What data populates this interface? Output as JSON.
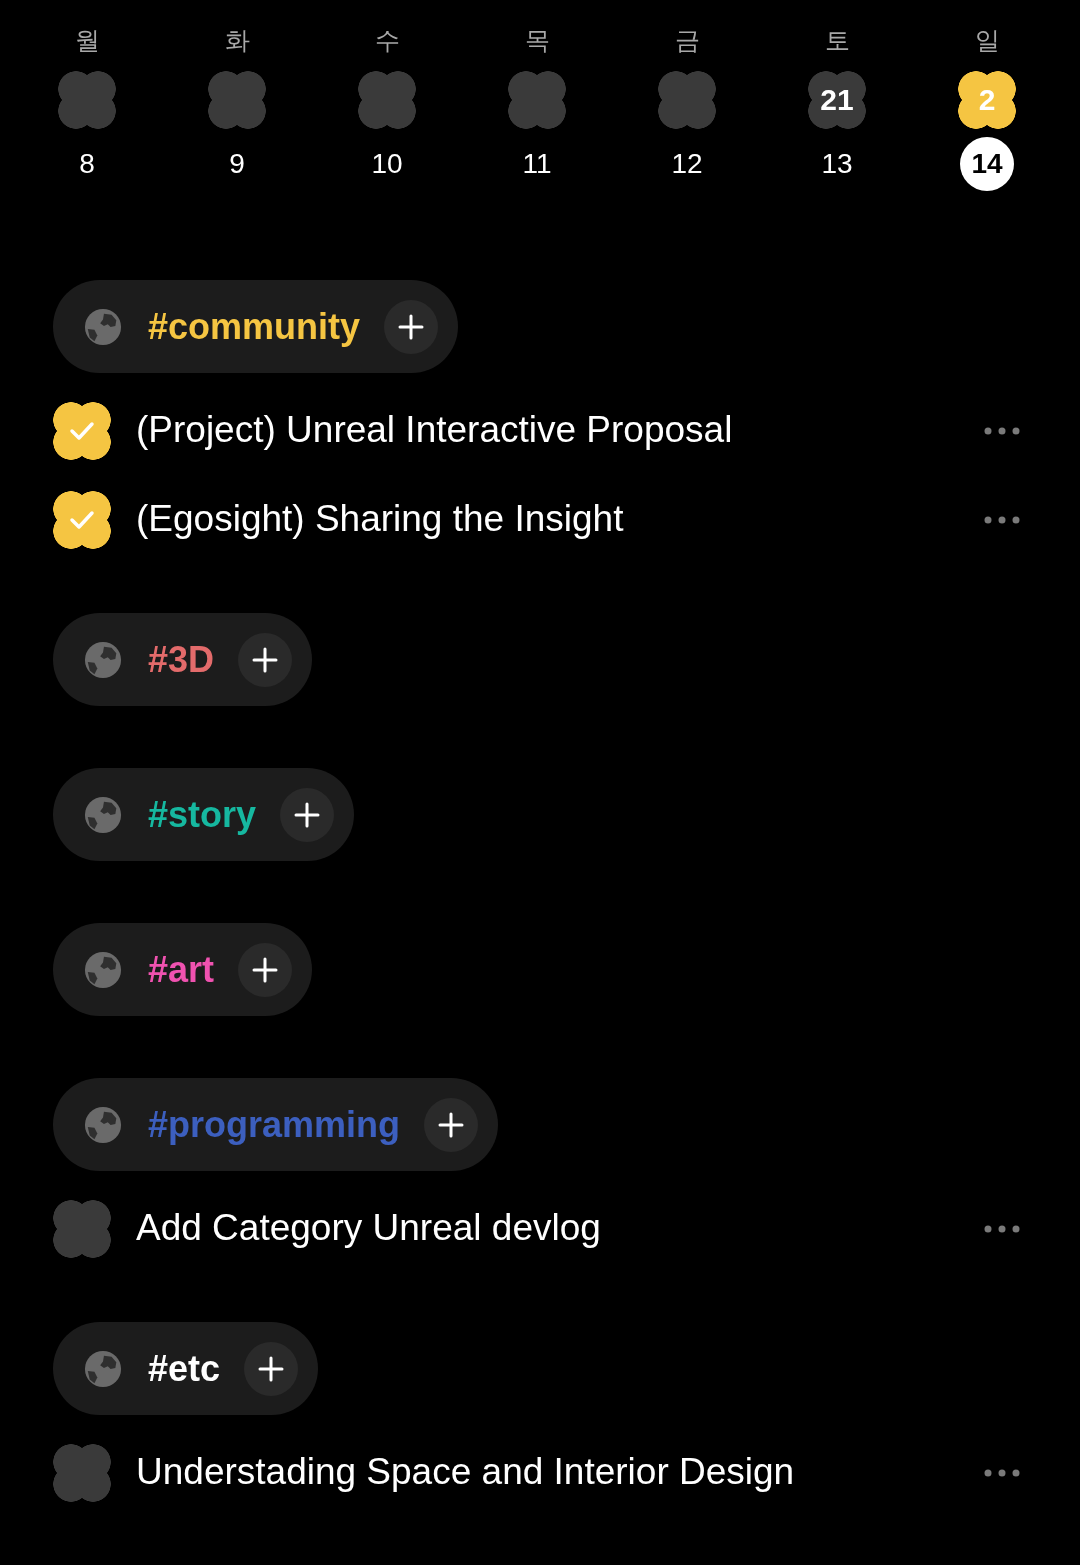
{
  "week": [
    {
      "weekday": "월",
      "date": "8",
      "selected": false,
      "color": "#3a3a3a"
    },
    {
      "weekday": "화",
      "date": "9",
      "selected": false,
      "color": "#3a3a3a"
    },
    {
      "weekday": "수",
      "date": "10",
      "selected": false,
      "color": "#3a3a3a"
    },
    {
      "weekday": "목",
      "date": "11",
      "selected": false,
      "color": "#3a3a3a"
    },
    {
      "weekday": "금",
      "date": "12",
      "selected": false,
      "color": "#3a3a3a"
    },
    {
      "weekday": "토",
      "date": "13",
      "count": "21",
      "selected": false,
      "color": "#3a3a3a"
    },
    {
      "weekday": "일",
      "date": "14",
      "count": "2",
      "selected": true,
      "color": "#f5c542"
    }
  ],
  "categories": [
    {
      "name": "#community",
      "color": "#f5c542",
      "tasks": [
        {
          "title": "(Project) Unreal Interactive Proposal",
          "checked": true
        },
        {
          "title": "(Egosight) Sharing the Insight",
          "checked": true
        }
      ]
    },
    {
      "name": "#3D",
      "color": "#e36b6b"
    },
    {
      "name": "#story",
      "color": "#16b8a0"
    },
    {
      "name": "#art",
      "color": "#f052b0"
    },
    {
      "name": "#programming",
      "color": "#3c5fbf",
      "tasks": [
        {
          "title": "Add Category Unreal devlog",
          "checked": false
        }
      ]
    },
    {
      "name": "#etc",
      "color": "#ffffff",
      "tasks": [
        {
          "title": "Understading Space and Interior Design",
          "checked": false
        }
      ]
    }
  ]
}
